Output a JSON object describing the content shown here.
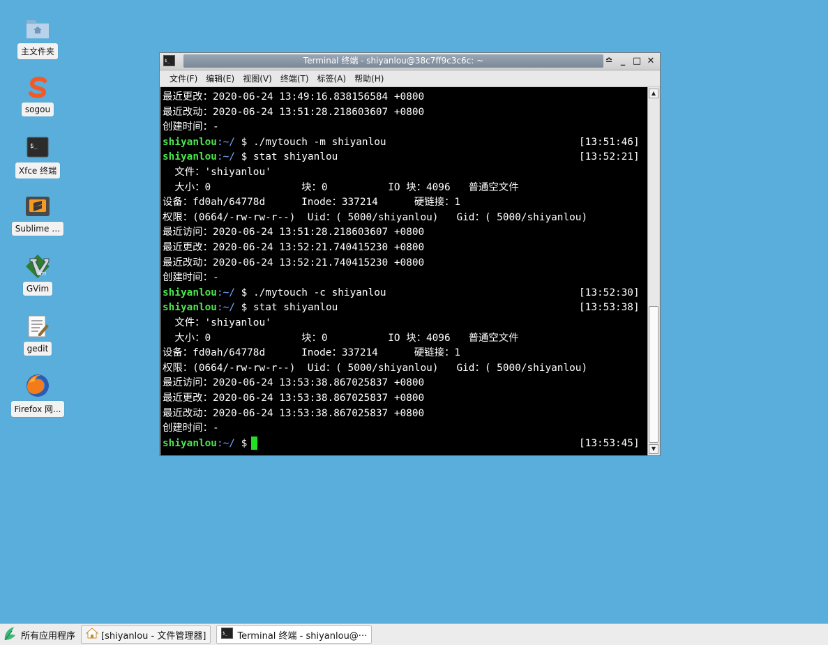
{
  "desktop": {
    "icons": [
      {
        "label": "主文件夹",
        "icon": "home-folder-icon"
      },
      {
        "label": "sogou",
        "icon": "sogou-icon"
      },
      {
        "label": "Xfce 终端",
        "icon": "terminal-icon"
      },
      {
        "label": "Sublime …",
        "icon": "sublime-icon"
      },
      {
        "label": "GVim",
        "icon": "gvim-icon"
      },
      {
        "label": "gedit",
        "icon": "gedit-icon"
      },
      {
        "label": "Firefox 网...",
        "icon": "firefox-icon"
      }
    ]
  },
  "window": {
    "title": "Terminal 终端 - shiyanlou@38c7ff9c3c6c: ~",
    "controls": {
      "shade": "≏",
      "minimize": "_",
      "maximize": "□",
      "close": "✕"
    },
    "menu": [
      "文件(F)",
      "编辑(E)",
      "视图(V)",
      "终端(T)",
      "标签(A)",
      "帮助(H)"
    ]
  },
  "terminal": {
    "lines": [
      {
        "text": "最近更改：2020-06-24 13:49:16.838156584 +0800"
      },
      {
        "text": "最近改动：2020-06-24 13:51:28.218603607 +0800"
      },
      {
        "text": "创建时间：-"
      },
      {
        "user": "shiyanlou",
        "path": ":~/",
        "cmd": " $ ./mytouch -m shiyanlou",
        "time": "[13:51:46]"
      },
      {
        "user": "shiyanlou",
        "path": ":~/",
        "cmd": " $ stat shiyanlou",
        "time": "[13:52:21]"
      },
      {
        "text": "  文件：'shiyanlou'"
      },
      {
        "text": "  大小：0               块：0          IO 块：4096   普通空文件"
      },
      {
        "text": "设备：fd0ah/64778d      Inode：337214      硬链接：1"
      },
      {
        "text": "权限：(0664/-rw-rw-r--)  Uid：( 5000/shiyanlou)   Gid：( 5000/shiyanlou)"
      },
      {
        "text": "最近访问：2020-06-24 13:51:28.218603607 +0800"
      },
      {
        "text": "最近更改：2020-06-24 13:52:21.740415230 +0800"
      },
      {
        "text": "最近改动：2020-06-24 13:52:21.740415230 +0800"
      },
      {
        "text": "创建时间：-"
      },
      {
        "user": "shiyanlou",
        "path": ":~/",
        "cmd": " $ ./mytouch -c shiyanlou",
        "time": "[13:52:30]"
      },
      {
        "user": "shiyanlou",
        "path": ":~/",
        "cmd": " $ stat shiyanlou",
        "time": "[13:53:38]"
      },
      {
        "text": "  文件：'shiyanlou'"
      },
      {
        "text": "  大小：0               块：0          IO 块：4096   普通空文件"
      },
      {
        "text": "设备：fd0ah/64778d      Inode：337214      硬链接：1"
      },
      {
        "text": "权限：(0664/-rw-rw-r--)  Uid：( 5000/shiyanlou)   Gid：( 5000/shiyanlou)"
      },
      {
        "text": "最近访问：2020-06-24 13:53:38.867025837 +0800"
      },
      {
        "text": "最近更改：2020-06-24 13:53:38.867025837 +0800"
      },
      {
        "text": "最近改动：2020-06-24 13:53:38.867025837 +0800"
      },
      {
        "text": "创建时间：-"
      },
      {
        "user": "shiyanlou",
        "path": ":~/",
        "cmd": " $",
        "time": "[13:53:45]",
        "cursor": true
      }
    ]
  },
  "taskbar": {
    "start_label": "所有应用程序",
    "tasks": [
      {
        "label": "[shiyanlou - 文件管理器]",
        "icon": "home-icon",
        "active": false
      },
      {
        "label": "Terminal 终端 - shiyanlou@···",
        "icon": "terminal-icon",
        "active": true
      }
    ]
  }
}
